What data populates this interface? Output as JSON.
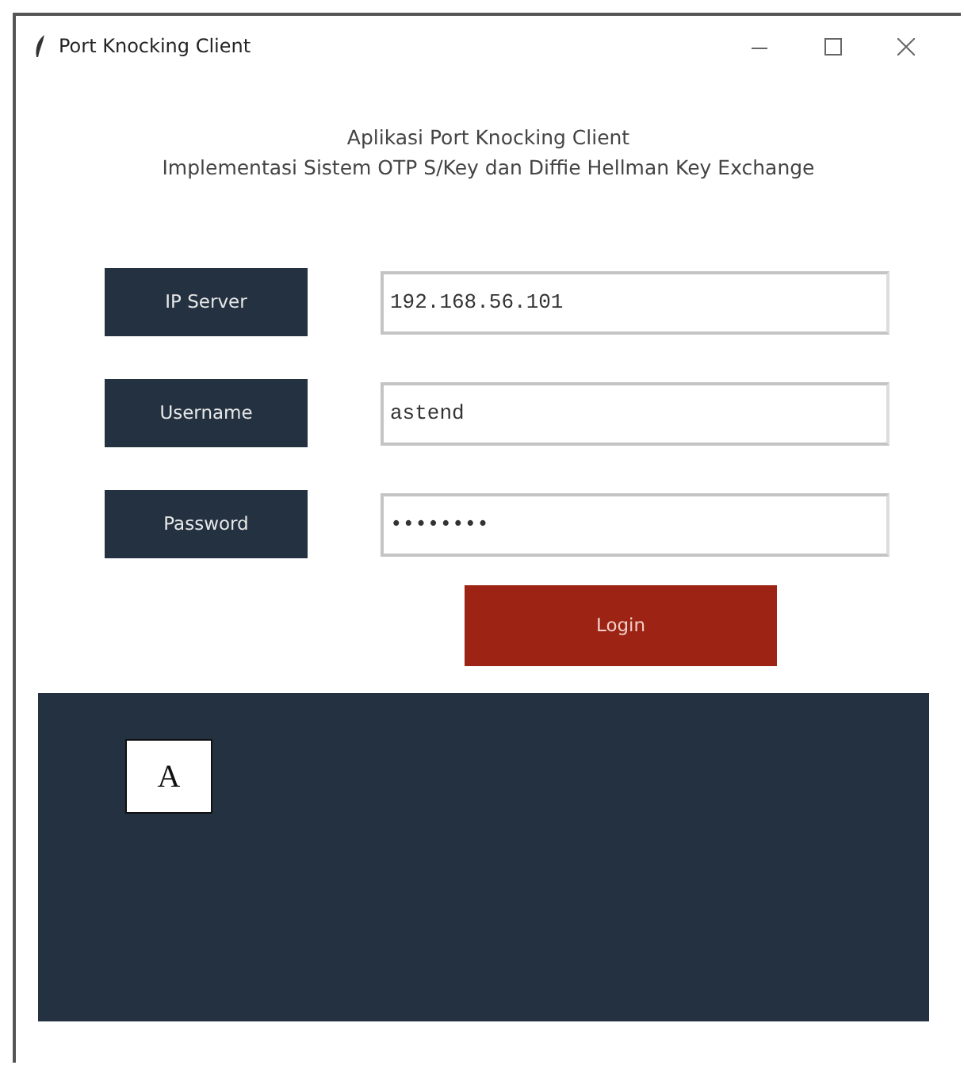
{
  "window": {
    "title": "Port Knocking Client"
  },
  "heading": [
    "Aplikasi Port Knocking Client",
    "Implementasi Sistem OTP S/Key dan Diffie Hellman Key Exchange"
  ],
  "fields": [
    {
      "label": "IP Server",
      "value": "192.168.56.101"
    },
    {
      "label": "Username",
      "value": "astend"
    },
    {
      "label": "Password",
      "value": "••••••••"
    }
  ],
  "login_button": "Login",
  "output_panel": {
    "annotation_label": "A"
  }
}
